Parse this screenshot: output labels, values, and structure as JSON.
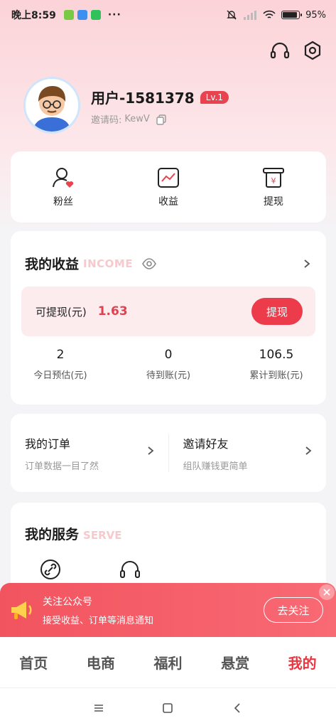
{
  "status_bar": {
    "time": "晚上8:59",
    "overflow": "···",
    "battery": "95%",
    "battery_level": 0.95
  },
  "profile": {
    "username": "用户-1581378",
    "level": "Lv.1",
    "invite_label": "邀请码:",
    "invite_code": "KewV"
  },
  "quick_actions": [
    {
      "label": "粉丝",
      "icon": "fans-icon"
    },
    {
      "label": "收益",
      "icon": "earnings-chart-icon"
    },
    {
      "label": "提现",
      "icon": "withdraw-icon"
    }
  ],
  "earnings": {
    "title": "我的收益",
    "title_en": "INCOME",
    "withdrawable_label": "可提现(元)",
    "withdrawable_value": "1.63",
    "withdraw_button": "提现",
    "stats": [
      {
        "value": "2",
        "label": "今日预估(元)"
      },
      {
        "value": "0",
        "label": "待到账(元)"
      },
      {
        "value": "106.5",
        "label": "累计到账(元)"
      }
    ]
  },
  "orders": {
    "my_orders_title": "我的订单",
    "my_orders_sub": "订单数据一目了然",
    "invite_title": "邀请好友",
    "invite_sub": "组队赚钱更简单"
  },
  "services": {
    "title": "我的服务",
    "title_en": "SERVE"
  },
  "banner": {
    "title": "关注公众号",
    "subtitle": "接受收益、订单等消息通知",
    "button": "去关注"
  },
  "tabs": [
    {
      "label": "首页",
      "active": false
    },
    {
      "label": "电商",
      "active": false
    },
    {
      "label": "福利",
      "active": false
    },
    {
      "label": "悬赏",
      "active": false
    },
    {
      "label": "我的",
      "active": true
    }
  ],
  "colors": {
    "accent": "#e8353f",
    "badge": "#e8434f"
  }
}
